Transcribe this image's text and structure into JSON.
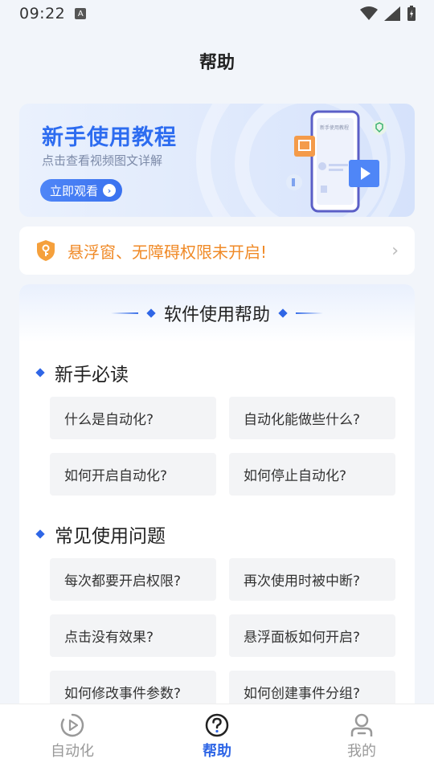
{
  "status": {
    "time": "09:22",
    "a_badge": "A"
  },
  "page": {
    "title": "帮助"
  },
  "banner": {
    "title": "新手使用教程",
    "subtitle": "点击查看视频图文详解",
    "button": "立即观看",
    "phone_caption": "新手使用教程"
  },
  "notice": {
    "text": "悬浮窗、无障碍权限未开启!"
  },
  "help": {
    "title": "软件使用帮助",
    "sections": [
      {
        "title": "新手必读",
        "items": [
          "什么是自动化?",
          "自动化能做些什么?",
          "如何开启自动化?",
          "如何停止自动化?"
        ]
      },
      {
        "title": "常见使用问题",
        "items": [
          "每次都要开启权限?",
          "再次使用时被中断?",
          "点击没有效果?",
          "悬浮面板如何开启?",
          "如何修改事件参数?",
          "如何创建事件分组?"
        ]
      }
    ]
  },
  "tabs": [
    {
      "label": "自动化",
      "icon": "play-circle-icon",
      "active": false
    },
    {
      "label": "帮助",
      "icon": "question-circle-icon",
      "active": true
    },
    {
      "label": "我的",
      "icon": "person-icon",
      "active": false
    }
  ],
  "colors": {
    "accent": "#2f66e6",
    "warning": "#f08a27"
  }
}
